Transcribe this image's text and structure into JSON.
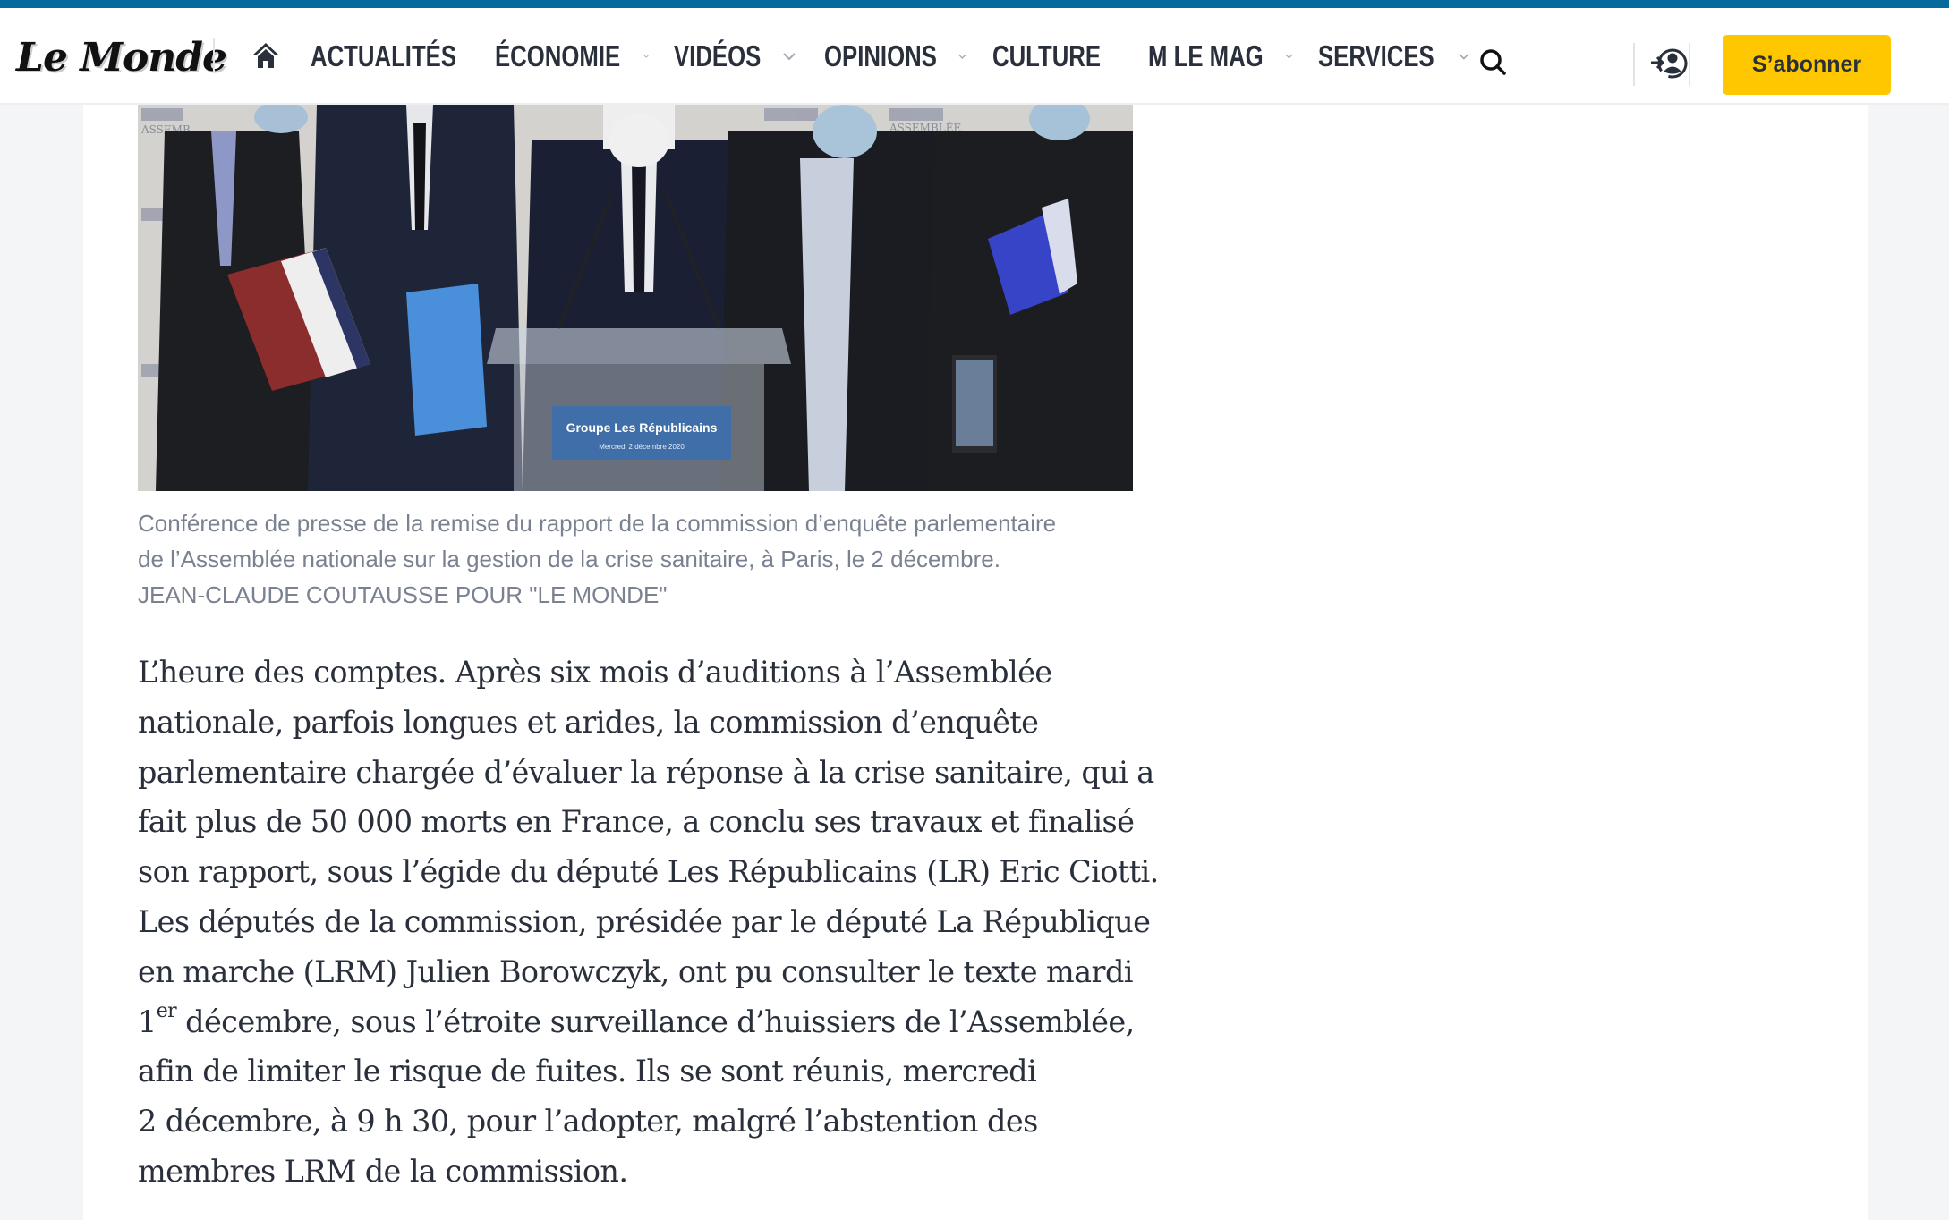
{
  "header": {
    "logo": "Le Monde",
    "nav": [
      {
        "label": "ACTUALITÉS",
        "has_dropdown": true
      },
      {
        "label": "ÉCONOMIE",
        "has_dropdown": true
      },
      {
        "label": "VIDÉOS",
        "has_dropdown": true
      },
      {
        "label": "OPINIONS",
        "has_dropdown": true
      },
      {
        "label": "CULTURE",
        "has_dropdown": true
      },
      {
        "label": "M LE MAG",
        "has_dropdown": true
      },
      {
        "label": "SERVICES",
        "has_dropdown": true
      }
    ],
    "icons": {
      "home": "home-icon",
      "search": "search-icon",
      "login": "login-user-icon"
    },
    "subscribe_label": "S’abonner"
  },
  "colors": {
    "top_bar": "#066b9c",
    "subscribe_bg": "#ffc700",
    "nav_text": "#2a303b",
    "caption_text": "#7a8291",
    "body_text": "#2a303b",
    "page_bg": "#f4f5f7"
  },
  "figure": {
    "image_alt": "Groupe Les Républicains press conference at the Assemblée nationale",
    "podium_sign": "Groupe Les Républicains",
    "podium_sub": "Mercredi 2 décembre 2020",
    "backdrop_text": "ASSEMBLÉE NATIONALE",
    "caption": "Conférence de presse de la remise du rapport de la commission d’enquête parlementaire de l’Assemblée nationale sur la gestion de la crise sanitaire, à Paris, le 2 décembre.",
    "caption_lines": [
      "Conférence de presse de la remise du rapport de la commission d’enquête parlementaire",
      "de l’Assemblée nationale sur la gestion de la crise sanitaire, à Paris, le 2 décembre."
    ],
    "credit": "JEAN-CLAUDE COUTAUSSE POUR \"LE MONDE\""
  },
  "article": {
    "lines": [
      "L’heure des comptes. Après six mois d’auditions à l’Assemblée",
      "nationale, parfois longues et arides, la commission d’enquête",
      "parlementaire chargée d’évaluer la réponse à la crise sanitaire, qui a",
      "fait plus de 50 000 morts en France, a conclu ses travaux et finalisé",
      "son rapport, sous l’égide du député Les Républicains (LR) Eric Ciotti.",
      "Les députés de la commission, présidée par le député La République",
      "en marche (LRM) Julien Borowczyk, ont pu consulter le texte mardi"
    ],
    "line8_prefix": "1",
    "line8_sup": "er",
    "line8_rest": " décembre, sous l’étroite surveillance d’huissiers de l’Assemblée,",
    "lines_after": [
      "afin de limiter le risque de fuites. Ils se sont réunis, mercredi",
      "2 décembre, à 9 h 30, pour l’adopter, malgré l’abstention des",
      "membres LRM de la commission."
    ]
  }
}
